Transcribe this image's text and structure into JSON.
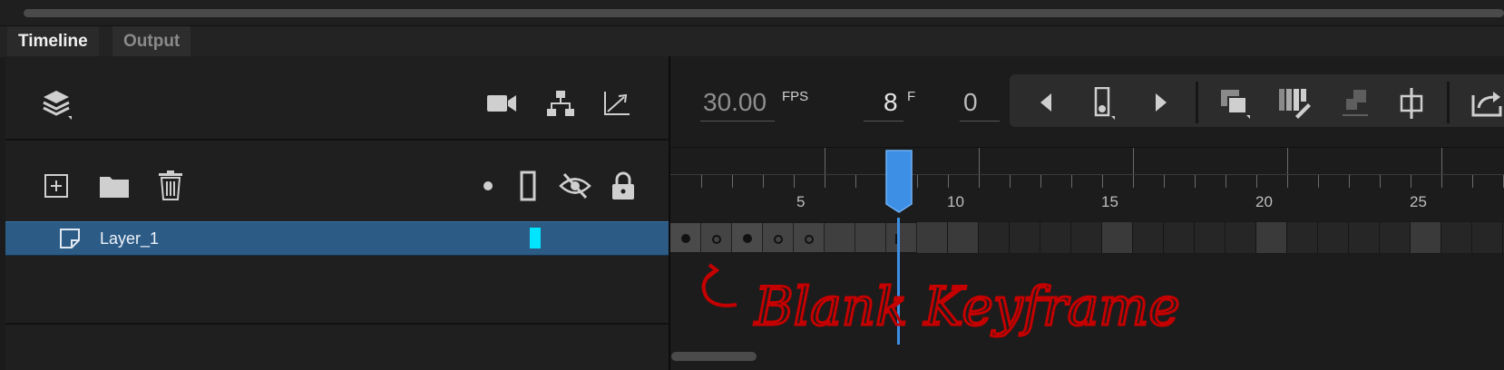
{
  "tabs": [
    {
      "label": "Timeline",
      "active": true
    },
    {
      "label": "Output",
      "active": false
    }
  ],
  "toolbar": {
    "fps_value": "30.00",
    "fps_unit": "FPS",
    "frame_value": "8",
    "frame_unit": "F",
    "time_value": "0",
    "icons": [
      "layers-icon",
      "camera-icon",
      "hierarchy-icon",
      "graph-icon",
      "prev-frame-icon",
      "marker-icon",
      "next-frame-icon",
      "onion-skin-icon",
      "edit-multiple-icon",
      "paste-icon",
      "center-frame-icon",
      "loop-icon"
    ]
  },
  "layer_tools": {
    "icons": [
      "new-layer-icon",
      "new-folder-icon",
      "delete-icon",
      "highlight-dot-icon",
      "outline-icon",
      "visibility-icon",
      "lock-icon"
    ]
  },
  "layers": [
    {
      "name": "Layer_1",
      "color": "#00e5ff",
      "selected": true
    }
  ],
  "ruler": {
    "labels": [
      "5",
      "10",
      "15",
      "20",
      "25"
    ]
  },
  "frames": {
    "current_frame": 8,
    "keyframes": [
      {
        "frame": 1,
        "type": "filled"
      },
      {
        "frame": 2,
        "type": "blank"
      },
      {
        "frame": 3,
        "type": "filled"
      },
      {
        "frame": 4,
        "type": "blank"
      },
      {
        "frame": 5,
        "type": "blank"
      }
    ]
  },
  "annotation": {
    "text": "Blank Keyframe",
    "color": "#c40000"
  },
  "colors": {
    "accent": "#3d8fe6",
    "layer_selected": "#2c5b86"
  }
}
